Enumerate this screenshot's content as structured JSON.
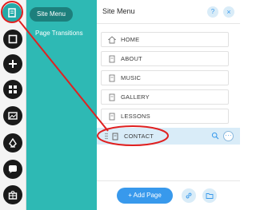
{
  "subpanel": {
    "site_menu": "Site Menu",
    "page_transitions": "Page Transitions"
  },
  "panel": {
    "title": "Site Menu",
    "help_label": "?",
    "close_label": "×",
    "more_label": "···",
    "add_page_label": "+ Add Page"
  },
  "menu": {
    "items": [
      {
        "label": "HOME",
        "icon": "home-icon"
      },
      {
        "label": "ABOUT",
        "icon": "page-icon"
      },
      {
        "label": "MUSIC",
        "icon": "page-icon"
      },
      {
        "label": "GALLERY",
        "icon": "page-icon"
      },
      {
        "label": "LESSONS",
        "icon": "page-icon"
      },
      {
        "label": "CONTACT",
        "icon": "page-icon",
        "selected": true
      }
    ]
  },
  "toolbar": {
    "icons": [
      "pages-icon",
      "background-icon",
      "add-icon",
      "apps-icon",
      "media-icon",
      "blog-pen-icon",
      "chat-icon",
      "store-icon"
    ]
  },
  "colors": {
    "teal": "#2eb9b4",
    "teal_dark": "#1d7f7c",
    "accent_blue": "#3899ec",
    "selected_row": "#d9ecf8",
    "annotation_red": "#e02020"
  }
}
